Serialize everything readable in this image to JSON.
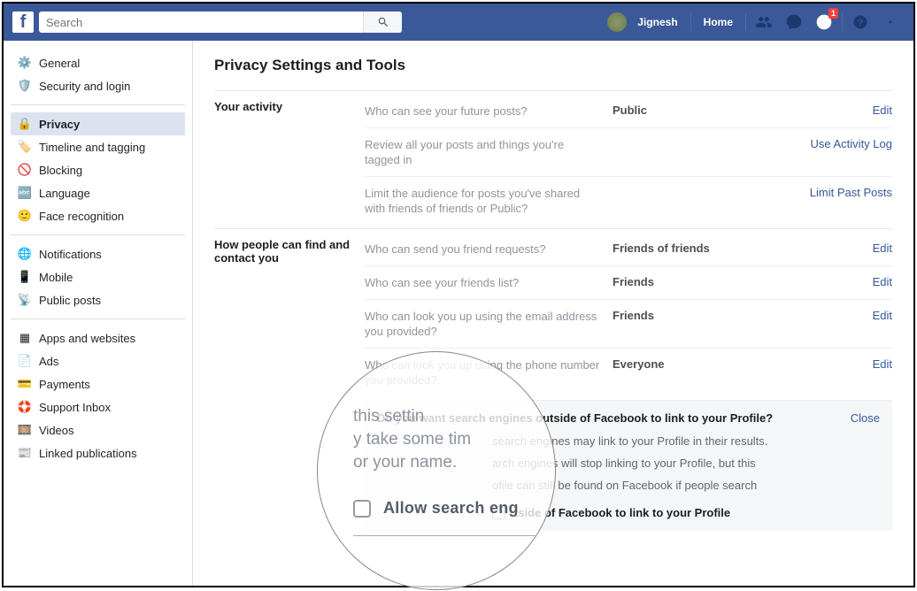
{
  "header": {
    "search_placeholder": "Search",
    "user_name": "Jignesh",
    "home": "Home",
    "notif_badge": "1"
  },
  "sidebar": {
    "g1": [
      {
        "label": "General"
      },
      {
        "label": "Security and login"
      }
    ],
    "g2": [
      {
        "label": "Privacy"
      },
      {
        "label": "Timeline and tagging"
      },
      {
        "label": "Blocking"
      },
      {
        "label": "Language"
      },
      {
        "label": "Face recognition"
      }
    ],
    "g3": [
      {
        "label": "Notifications"
      },
      {
        "label": "Mobile"
      },
      {
        "label": "Public posts"
      }
    ],
    "g4": [
      {
        "label": "Apps and websites"
      },
      {
        "label": "Ads"
      },
      {
        "label": "Payments"
      },
      {
        "label": "Support Inbox"
      },
      {
        "label": "Videos"
      },
      {
        "label": "Linked publications"
      }
    ]
  },
  "main": {
    "title": "Privacy Settings and Tools",
    "sec1": {
      "label": "Your activity",
      "r1": {
        "q": "Who can see your future posts?",
        "v": "Public",
        "a": "Edit"
      },
      "r2": {
        "q": "Review all your posts and things you're tagged in",
        "a": "Use Activity Log"
      },
      "r3": {
        "q": "Limit the audience for posts you've shared with friends of friends or Public?",
        "a": "Limit Past Posts"
      }
    },
    "sec2": {
      "label": "How people can find and contact you",
      "r1": {
        "q": "Who can send you friend requests?",
        "v": "Friends of friends",
        "a": "Edit"
      },
      "r2": {
        "q": "Who can see your friends list?",
        "v": "Friends",
        "a": "Edit"
      },
      "r3": {
        "q": "Who can look you up using the email address you provided?",
        "v": "Friends",
        "a": "Edit"
      },
      "r4": {
        "q": "Who can look you up using the phone number you provided?",
        "v": "Everyone",
        "a": "Edit"
      },
      "exp": {
        "q": "Do you want search engines outside of Facebook to link to your Profile?",
        "close": "Close",
        "p1": "search engines may link to your Profile in their results.",
        "p2": "arch engines will stop linking to your Profile, but this",
        "p3": "ofile can still be found on Facebook if people search",
        "check_label": "tside of Facebook to link to your Profile"
      }
    }
  },
  "mag": {
    "t1": "this settin",
    "t2": "y take some tim",
    "t3": "or your name.",
    "label": "Allow search eng"
  }
}
